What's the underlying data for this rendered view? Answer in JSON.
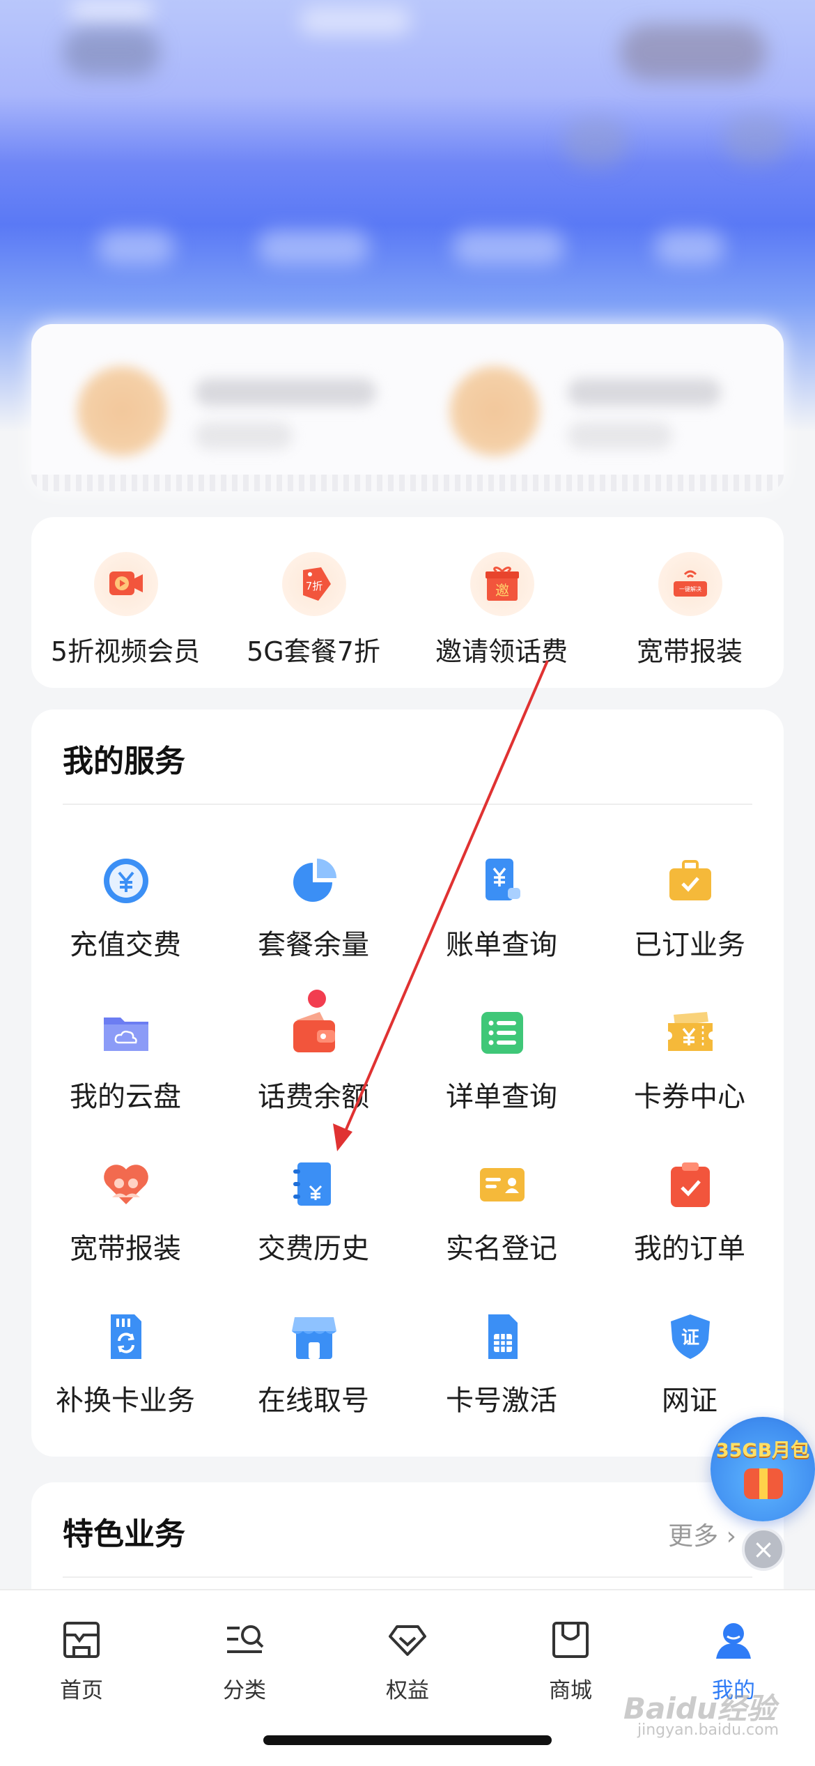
{
  "promos": [
    {
      "label": "5折视频会员",
      "icon": "video-member-icon"
    },
    {
      "label": "5G套餐7折",
      "icon": "discount-tag-icon",
      "tag": "7折"
    },
    {
      "label": "邀请领话费",
      "icon": "invite-gift-icon",
      "tag": "邀"
    },
    {
      "label": "宽带报装",
      "icon": "broadband-router-icon",
      "tag": "一键解决"
    }
  ],
  "services": {
    "title": "我的服务",
    "items": [
      {
        "label": "充值交费",
        "icon": "recharge-icon"
      },
      {
        "label": "套餐余量",
        "icon": "pie-chart-icon"
      },
      {
        "label": "账单查询",
        "icon": "bill-icon"
      },
      {
        "label": "已订业务",
        "icon": "briefcase-icon"
      },
      {
        "label": "我的云盘",
        "icon": "cloud-folder-icon"
      },
      {
        "label": "话费余额",
        "icon": "wallet-icon"
      },
      {
        "label": "详单查询",
        "icon": "list-icon"
      },
      {
        "label": "卡券中心",
        "icon": "coupon-icon"
      },
      {
        "label": "宽带报装",
        "icon": "heart-icon"
      },
      {
        "label": "交费历史",
        "icon": "payment-history-icon"
      },
      {
        "label": "实名登记",
        "icon": "id-card-icon"
      },
      {
        "label": "我的订单",
        "icon": "order-clipboard-icon"
      },
      {
        "label": "补换卡业务",
        "icon": "sim-swap-icon"
      },
      {
        "label": "在线取号",
        "icon": "store-icon"
      },
      {
        "label": "卡号激活",
        "icon": "sim-card-icon"
      },
      {
        "label": "网证",
        "icon": "shield-cert-icon",
        "glyph": "证"
      }
    ]
  },
  "featured": {
    "title": "特色业务",
    "more": "更多"
  },
  "float_badge": {
    "label": "35GB月包"
  },
  "tabbar": [
    {
      "label": "首页",
      "icon": "home-icon",
      "active": false
    },
    {
      "label": "分类",
      "icon": "category-search-icon",
      "active": false
    },
    {
      "label": "权益",
      "icon": "diamond-icon",
      "active": false
    },
    {
      "label": "商城",
      "icon": "shopping-bag-icon",
      "active": false
    },
    {
      "label": "我的",
      "icon": "user-icon",
      "active": true
    }
  ],
  "watermark": {
    "text": "Baidu经验",
    "sub": "jingyan.baidu.com"
  },
  "colors": {
    "accent": "#2f7cf6",
    "annotation_arrow": "#e03232",
    "badge_dot": "#f23d4f"
  }
}
